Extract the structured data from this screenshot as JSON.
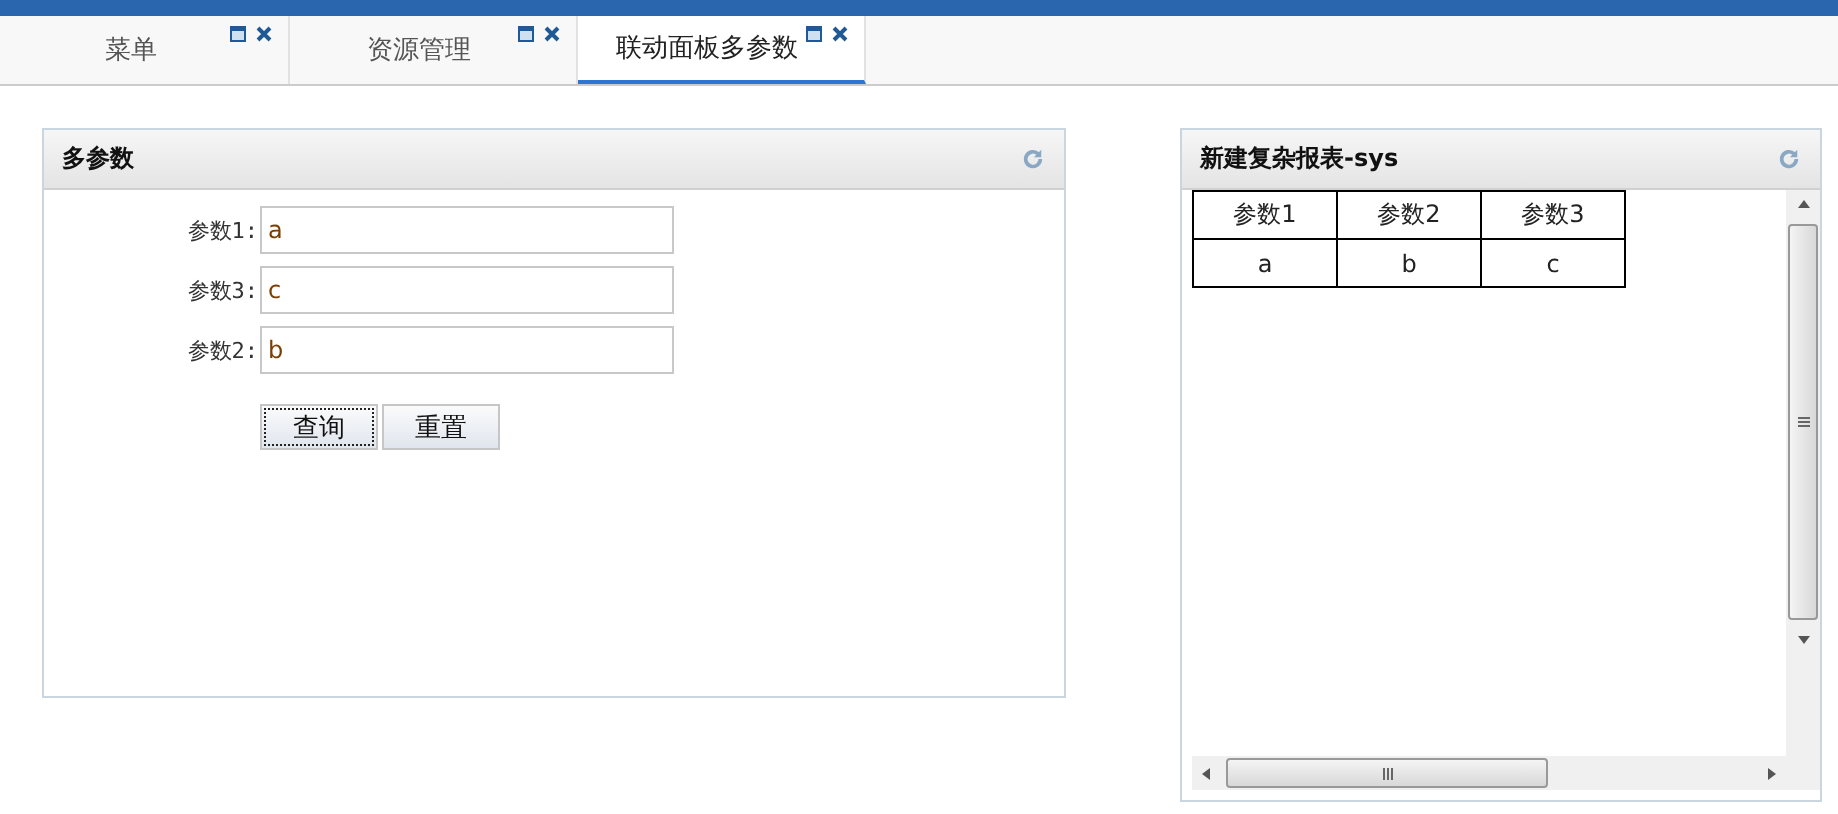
{
  "tabs": [
    {
      "label": "菜单",
      "selected": false
    },
    {
      "label": "资源管理",
      "selected": false
    },
    {
      "label": "联动面板多参数",
      "selected": true
    }
  ],
  "params_panel": {
    "title": "多参数",
    "fields": [
      {
        "label": "参数1:",
        "value": "a"
      },
      {
        "label": "参数3:",
        "value": "c"
      },
      {
        "label": "参数2:",
        "value": "b"
      }
    ],
    "buttons": [
      {
        "label": "查询",
        "focused": true
      },
      {
        "label": "重置",
        "focused": false
      }
    ]
  },
  "report_panel": {
    "title": "新建复杂报表-sys",
    "table": {
      "columns": [
        "参数1",
        "参数2",
        "参数3"
      ],
      "rows": [
        [
          "a",
          "b",
          "c"
        ]
      ]
    }
  }
}
